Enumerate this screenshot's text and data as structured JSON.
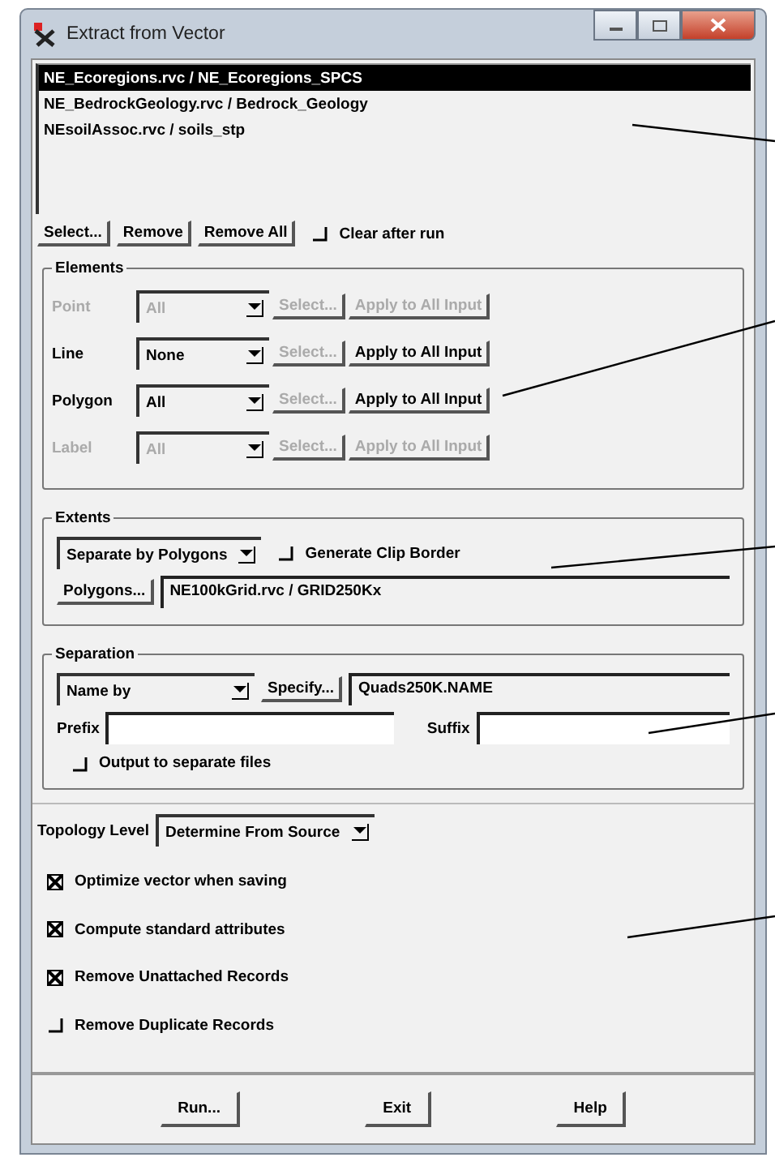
{
  "window": {
    "title": "Extract from Vector"
  },
  "input_list": {
    "items": [
      {
        "label": "NE_Ecoregions.rvc / NE_Ecoregions_SPCS",
        "selected": true
      },
      {
        "label": "NE_BedrockGeology.rvc / Bedrock_Geology",
        "selected": false
      },
      {
        "label": "NEsoilAssoc.rvc / soils_stp",
        "selected": false
      }
    ]
  },
  "list_buttons": [
    "Select...",
    "Remove",
    "Remove All"
  ],
  "clear_after_run": {
    "label": "Clear after run",
    "checked": false
  },
  "elements": {
    "title": "Elements",
    "rows": [
      {
        "label": "Point",
        "value": "All",
        "disabled": true,
        "select_button": "Select...",
        "select_disabled": true,
        "apply_button": "Apply to All Input"
      },
      {
        "label": "Line",
        "value": "None",
        "disabled": false,
        "select_button": "Select...",
        "select_disabled": true,
        "apply_button": "Apply to All Input"
      },
      {
        "label": "Polygon",
        "value": "All",
        "disabled": false,
        "select_button": "Select...",
        "select_disabled": true,
        "apply_button": "Apply to All Input"
      },
      {
        "label": "Label",
        "value": "All",
        "disabled": true,
        "select_button": "Select...",
        "select_disabled": true,
        "apply_button": "Apply to All Input"
      }
    ]
  },
  "extents": {
    "title": "Extents",
    "mode": "Separate by Polygons",
    "clip_border": {
      "label": "Generate Clip Border",
      "checked": false
    },
    "polygons_button": "Polygons...",
    "polygons_value": "NE100kGrid.rvc / GRID250Kx"
  },
  "separation": {
    "title": "Separation",
    "name_by": "Name by",
    "specify_button": "Specify...",
    "specify_value": "Quads250K.NAME",
    "prefix_label": "Prefix",
    "suffix_label": "Suffix",
    "output_separate": {
      "label": "Output to separate files",
      "checked": false
    }
  },
  "topology": {
    "label": "Topology Level",
    "value": "Determine From Source"
  },
  "options": [
    {
      "label": "Optimize vector when saving",
      "checked": true
    },
    {
      "label": "Compute standard attributes",
      "checked": true
    },
    {
      "label": "Remove Unattached Records",
      "checked": true
    },
    {
      "label": "Remove Duplicate Records",
      "checked": false
    }
  ],
  "footer_buttons": [
    "Run...",
    "Exit",
    "Help"
  ]
}
